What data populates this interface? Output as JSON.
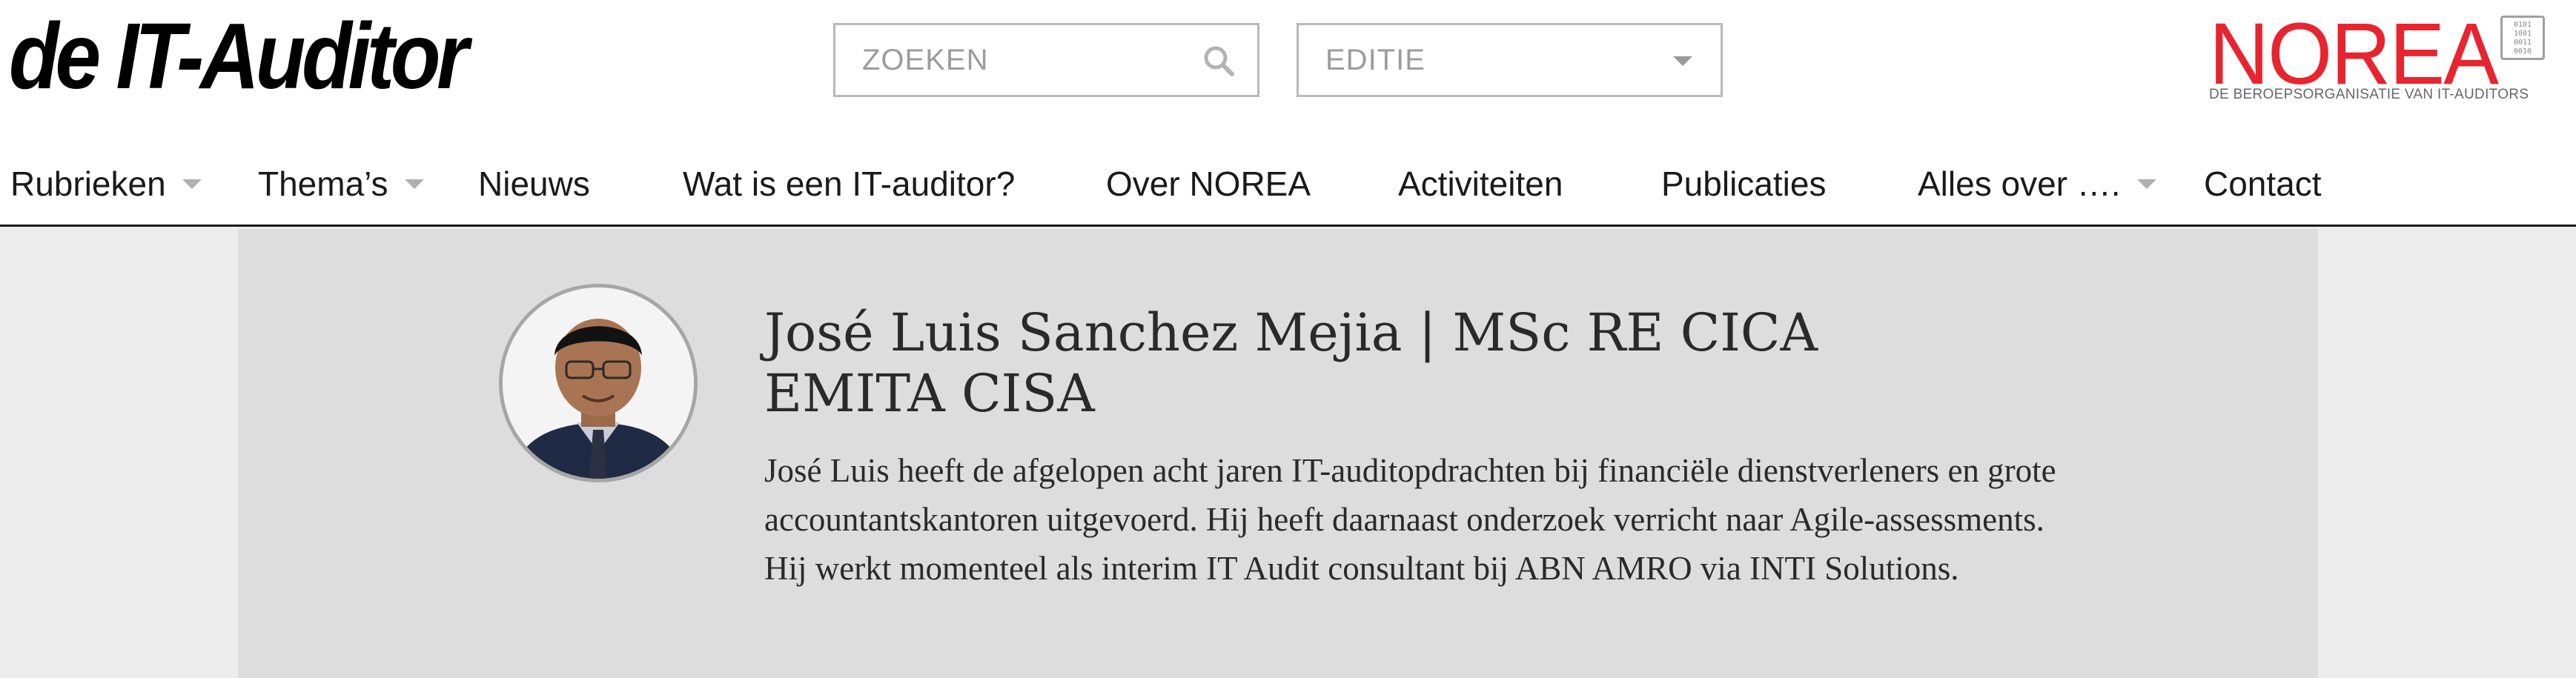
{
  "site": {
    "logo_text": "de IT-Auditor"
  },
  "search": {
    "placeholder": "ZOEKEN"
  },
  "edition": {
    "selected": "EDITIE"
  },
  "norea": {
    "name": "NOREA",
    "tagline": "DE BEROEPSORGANISATIE VAN IT-AUDITORS",
    "badge": "0101\n1001\n0011\n0010",
    "color": "#e8242f"
  },
  "nav": {
    "items": [
      {
        "label": "Rubrieken",
        "dropdown": true
      },
      {
        "label": "Thema’s",
        "dropdown": true
      },
      {
        "label": "Nieuws",
        "dropdown": false
      },
      {
        "label": "Wat is een IT-auditor?",
        "dropdown": false
      },
      {
        "label": "Over NOREA",
        "dropdown": false
      },
      {
        "label": "Activiteiten",
        "dropdown": false
      },
      {
        "label": "Publicaties",
        "dropdown": false
      },
      {
        "label": "Alles over ….",
        "dropdown": true
      },
      {
        "label": "Contact",
        "dropdown": false
      }
    ]
  },
  "author": {
    "name": "José Luis Sanchez Mejia | MSc RE CICA EMITA CISA",
    "bio": "José Luis heeft de afgelopen acht jaren IT-auditopdrachten bij financiële dienstverleners en grote accountantskantoren uitgevoerd. Hij heeft daarnaast onderzoek verricht naar Agile-assessments. Hij werkt momenteel als interim IT Audit consultant bij ABN AMRO via INTI Solutions."
  },
  "colors": {
    "header_bg": "#ffffff",
    "page_bg": "#ececec",
    "content_bg": "#dddddd",
    "nav_border": "#1a1a1a"
  }
}
